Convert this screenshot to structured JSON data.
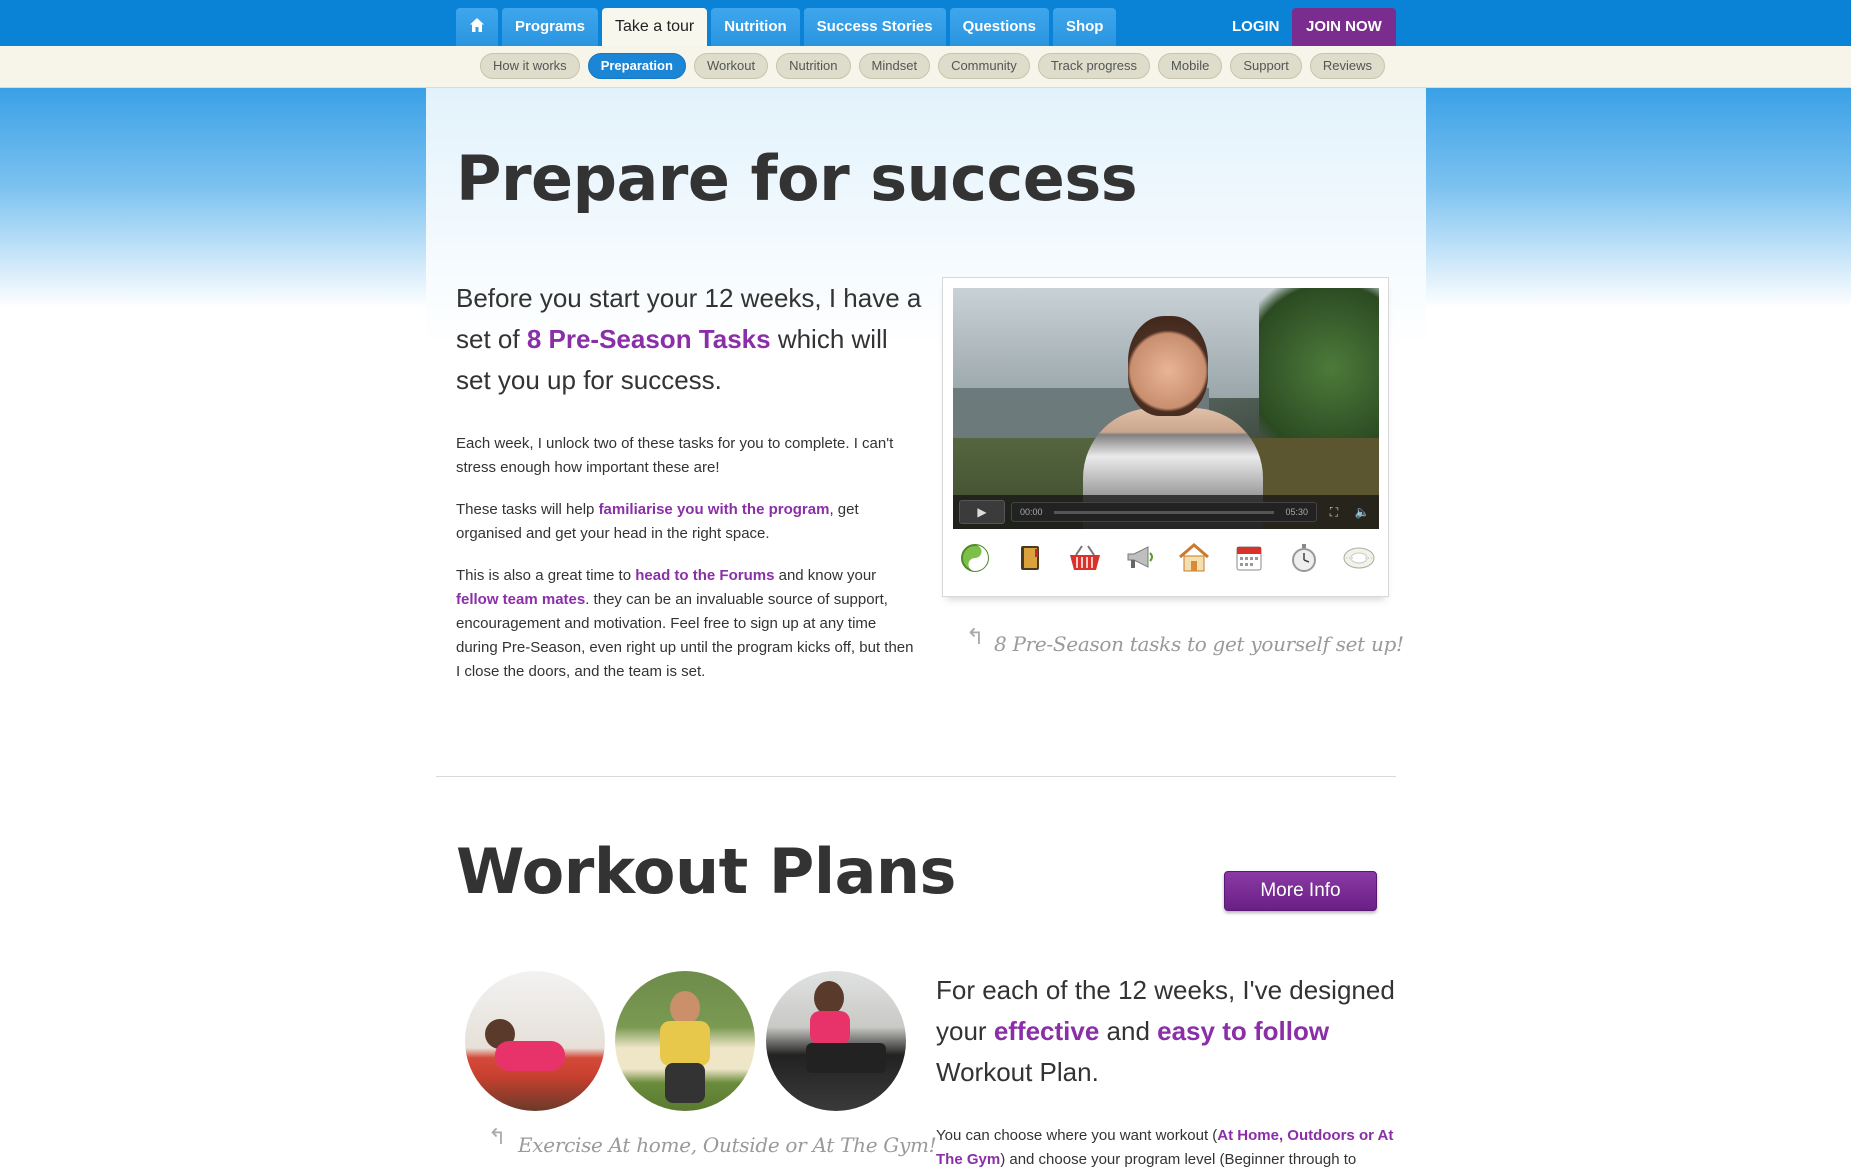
{
  "topnav": {
    "home_icon": "home-icon",
    "tabs": [
      {
        "label": "Programs"
      },
      {
        "label": "Take a tour",
        "active": true
      },
      {
        "label": "Nutrition"
      },
      {
        "label": "Success Stories"
      },
      {
        "label": "Questions"
      },
      {
        "label": "Shop"
      }
    ],
    "login": "LOGIN",
    "join": "JOIN NOW"
  },
  "subnav": [
    {
      "label": "How it works"
    },
    {
      "label": "Preparation",
      "active": true
    },
    {
      "label": "Workout"
    },
    {
      "label": "Nutrition"
    },
    {
      "label": "Mindset"
    },
    {
      "label": "Community"
    },
    {
      "label": "Track progress"
    },
    {
      "label": "Mobile"
    },
    {
      "label": "Support"
    },
    {
      "label": "Reviews"
    }
  ],
  "section1": {
    "title": "Prepare for success",
    "lead_pre": "Before you start your 12 weeks, I have a set of ",
    "lead_highlight": "8 Pre-Season Tasks",
    "lead_post": " which will set you up for success.",
    "p1": "Each week, I unlock two of these tasks for you to complete. I can't stress enough how important these are!",
    "p2_pre": "These tasks will help ",
    "p2_link": "familiarise you with the program",
    "p2_post": ", get organised and get your head in the right space.",
    "p3_pre": "This is also a great time to ",
    "p3_link1": "head to the Forums",
    "p3_mid": " and know your ",
    "p3_link2": "fellow team mates",
    "p3_post": ". they can be an invaluable source of support, encouragement and motivation. Feel free to sign up at any time during Pre-Season, even right up until the program kicks off, but then I close the doors, and the team is set.",
    "video": {
      "time_start": "00:00",
      "time_end": "05:30"
    },
    "task_icons": [
      "yin-yang-icon",
      "notebook-icon",
      "basket-icon",
      "megaphone-icon",
      "house-icon",
      "calendar-icon",
      "stopwatch-icon",
      "tape-measure-icon"
    ],
    "caption": "8 Pre-Season tasks to get yourself set up!"
  },
  "section2": {
    "title": "Workout Plans",
    "more_info": "More Info",
    "caption": "Exercise At home, Outside or At The Gym!",
    "lead_pre": "For each of the 12 weeks, I've designed your ",
    "lead_hl1": "effective",
    "lead_mid": " and ",
    "lead_hl2": "easy to follow",
    "lead_post": " Workout Plan.",
    "p1_pre": "You can choose where you want workout (",
    "p1_link": "At Home, Outdoors or At The Gym",
    "p1_post": ") and choose your program level (Beginner through to"
  },
  "colors": {
    "nav_blue": "#0a83d6",
    "accent_purple": "#8a2fa8",
    "join_purple": "#7a2d8f"
  }
}
